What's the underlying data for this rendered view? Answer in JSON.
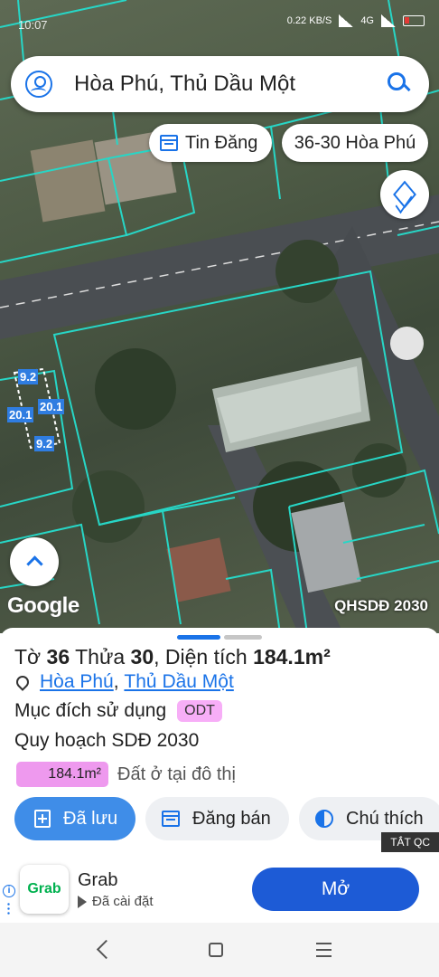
{
  "status_bar": {
    "time": "10:07",
    "network_speed": "0.22",
    "network_unit": "KB/S",
    "network_type": "4G"
  },
  "search": {
    "query": "Hòa Phú, Thủ Dầu Một"
  },
  "chips": {
    "tin_dang": "Tin Đăng",
    "location": "36-30 Hòa Phú"
  },
  "map": {
    "google_label": "Google",
    "layer_label": "QHSDĐ 2030",
    "dimensions": [
      "9.2",
      "20.1",
      "20.1",
      "9.2"
    ]
  },
  "parcel": {
    "to_label": "Tờ",
    "to_value": "36",
    "thua_label": "Thửa",
    "thua_value": "30",
    "area_label": "Diện tích",
    "area_value": "184.1m²",
    "ward": "Hòa Phú",
    "separator": ",",
    "city": "Thủ Dầu Một",
    "purpose_label": "Mục đích sử dụng",
    "purpose_code": "ODT",
    "plan_label": "Quy hoạch SDĐ 2030",
    "plan_area": "184.1m²",
    "plan_desc": "Đất ở tại đô thị",
    "plan_color": "#ee99ee"
  },
  "actions": {
    "saved": "Đã lưu",
    "sell": "Đăng bán",
    "legend": "Chú thích"
  },
  "ad": {
    "tag": "TẮT QC",
    "app_name": "Grab",
    "logo_text": "Grab",
    "installed": "Đã cài đặt",
    "open": "Mở",
    "brand_color": "#00b14f"
  },
  "colors": {
    "accent": "#1a73e8",
    "parcel_lines": "#27d6c6"
  }
}
